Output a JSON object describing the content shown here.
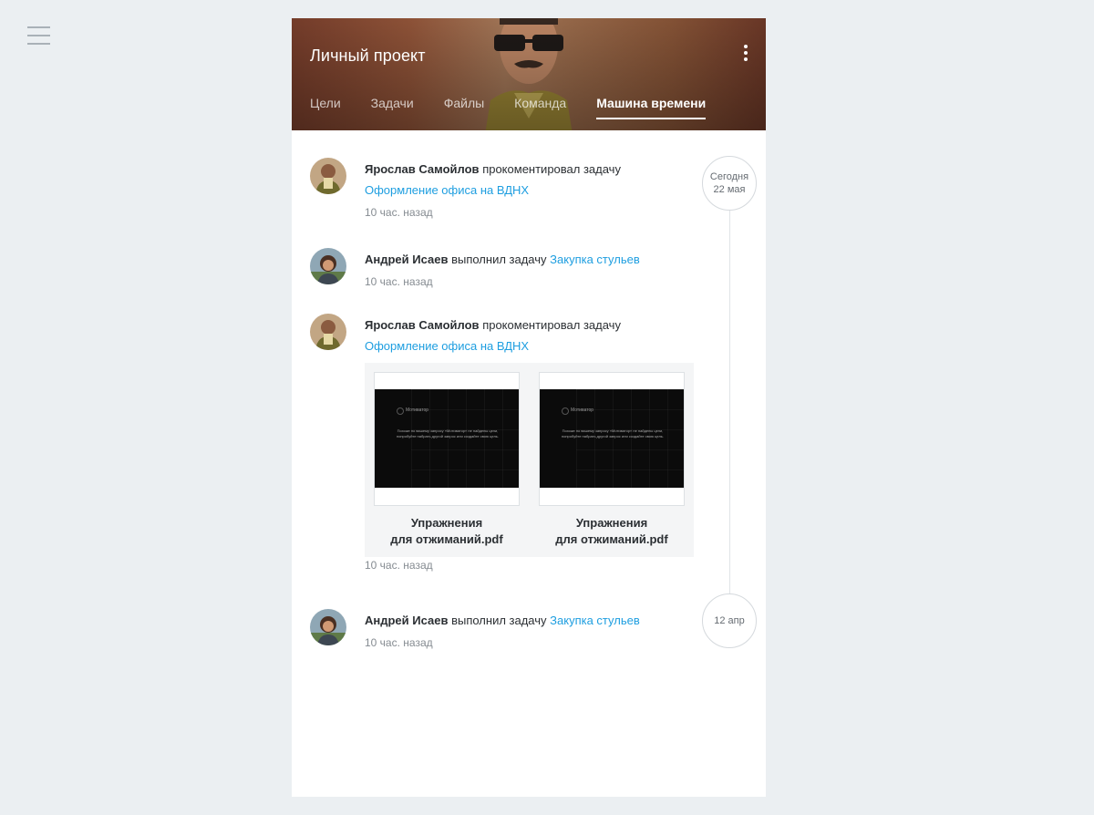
{
  "header": {
    "title": "Личный проект",
    "tabs": [
      {
        "label": "Цели",
        "active": false
      },
      {
        "label": "Задачи",
        "active": false
      },
      {
        "label": "Файлы",
        "active": false
      },
      {
        "label": "Команда",
        "active": false
      },
      {
        "label": "Машина времени",
        "active": true
      }
    ]
  },
  "timeline": {
    "dates": [
      {
        "line1": "Сегодня",
        "line2": "22 мая"
      },
      {
        "line1": "12 апр",
        "line2": ""
      }
    ],
    "events": [
      {
        "author": "Ярослав Самойлов",
        "action": "прокоментировал задачу",
        "task": "Оформление офиса на ВДНХ",
        "time": "10 час. назад"
      },
      {
        "author": "Андрей Исаев",
        "action": "выполнил задачу",
        "task": "Закупка стульев",
        "time": "10 час. назад"
      },
      {
        "author": "Ярослав Самойлов",
        "action": "прокоментировал задачу",
        "task": "Оформление офиса на ВДНХ",
        "time": "10 час. назад",
        "attachments": [
          {
            "name_line1": "Упражнения",
            "name_line2": "для отжиманий.pdf",
            "preview_logo": "Мотиватор",
            "preview_text": "Похоже по вашему запросу «Мотиватор» не найдены цели, попробуйте набрать другой запрос или создайте свою цель."
          },
          {
            "name_line1": "Упражнения",
            "name_line2": "для отжиманий.pdf",
            "preview_logo": "Мотиватор",
            "preview_text": "Похоже по вашему запросу «Мотиватор» не найдены цели, попробуйте набрать другой запрос или создайте свою цель."
          }
        ]
      },
      {
        "author": "Андрей Исаев",
        "action": "выполнил задачу",
        "task": "Закупка стульев",
        "time": "10 час. назад"
      }
    ]
  },
  "colors": {
    "background": "#ebeff2",
    "link": "#1e9ee0",
    "text": "#2b2f33",
    "muted": "#858b91"
  }
}
